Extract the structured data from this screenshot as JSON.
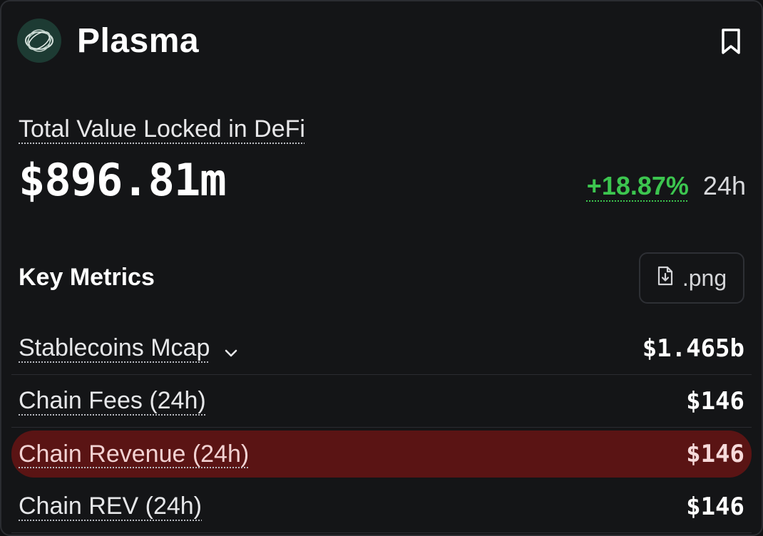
{
  "header": {
    "chain_name": "Plasma",
    "logo_icon": "plasma-logo-icon",
    "bookmark_icon": "bookmark-icon"
  },
  "tvl": {
    "label": "Total Value Locked in DeFi",
    "value": "$896.81m",
    "change_pct": "+18.87%",
    "change_period": "24h",
    "change_color": "#3cc54f"
  },
  "key_metrics": {
    "title": "Key Metrics",
    "download_button": {
      "label": ".png",
      "icon": "file-download-icon"
    },
    "rows": [
      {
        "label": "Stablecoins Mcap",
        "value": "$1.465b",
        "has_dropdown": true
      },
      {
        "label": "Chain Fees (24h)",
        "value": "$146"
      },
      {
        "label": "Chain Revenue (24h)",
        "value": "$146",
        "highlighted": true,
        "highlight_color": "#5a1414"
      },
      {
        "label": "Chain REV (24h)",
        "value": "$146"
      }
    ]
  }
}
